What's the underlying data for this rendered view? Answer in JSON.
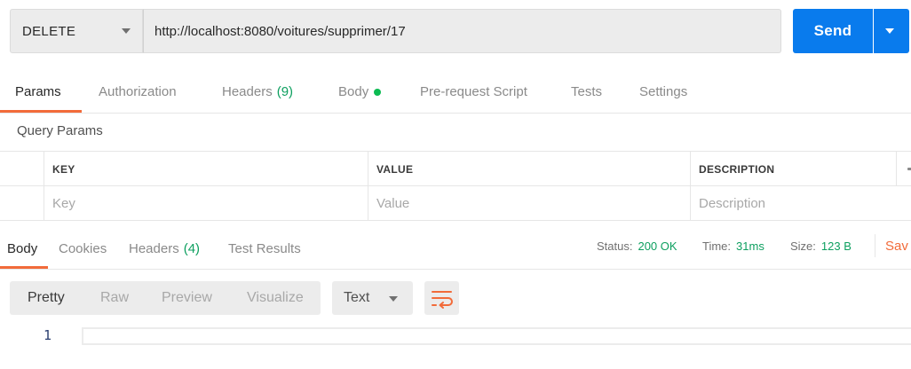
{
  "request": {
    "method": "DELETE",
    "url": "http://localhost:8080/voitures/supprimer/17",
    "send_label": "Send"
  },
  "request_tabs": [
    {
      "label": "Params",
      "active": true
    },
    {
      "label": "Authorization"
    },
    {
      "label": "Headers",
      "count": "(9)"
    },
    {
      "label": "Body",
      "indicator": "dot"
    },
    {
      "label": "Pre-request Script"
    },
    {
      "label": "Tests"
    },
    {
      "label": "Settings"
    }
  ],
  "query_params": {
    "title": "Query Params",
    "headers": [
      "KEY",
      "VALUE",
      "DESCRIPTION"
    ],
    "placeholders": [
      "Key",
      "Value",
      "Description"
    ]
  },
  "response_tabs": [
    {
      "label": "Body",
      "active": true
    },
    {
      "label": "Cookies"
    },
    {
      "label": "Headers",
      "count": "(4)"
    },
    {
      "label": "Test Results"
    }
  ],
  "response_status": {
    "status_label": "Status:",
    "status_value": "200 OK",
    "time_label": "Time:",
    "time_value": "31ms",
    "size_label": "Size:",
    "size_value": "123 B",
    "save_label": "Sav"
  },
  "view_modes": [
    "Pretty",
    "Raw",
    "Preview",
    "Visualize"
  ],
  "format": "Text",
  "editor": {
    "line_number": "1"
  },
  "colors": {
    "accent": "#f26b3a",
    "send": "#097bed",
    "ok": "#0d9f5f",
    "dot": "#0cbb52"
  },
  "icons": [
    "chevron-down-icon",
    "wrap-lines-icon"
  ]
}
